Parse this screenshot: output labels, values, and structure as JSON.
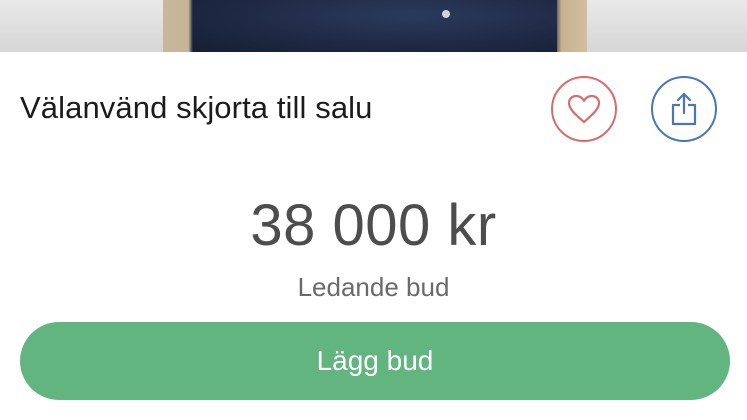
{
  "listing": {
    "title": "Välanvänd skjorta till salu",
    "price": "38 000 kr",
    "price_label": "Ledande bud",
    "bid_button_label": "Lägg bud"
  },
  "icons": {
    "favorite": "heart-icon",
    "share": "share-icon"
  },
  "colors": {
    "favorite_accent": "#d86c6a",
    "share_accent": "#4a76b8",
    "bid_button": "#63b57f"
  }
}
